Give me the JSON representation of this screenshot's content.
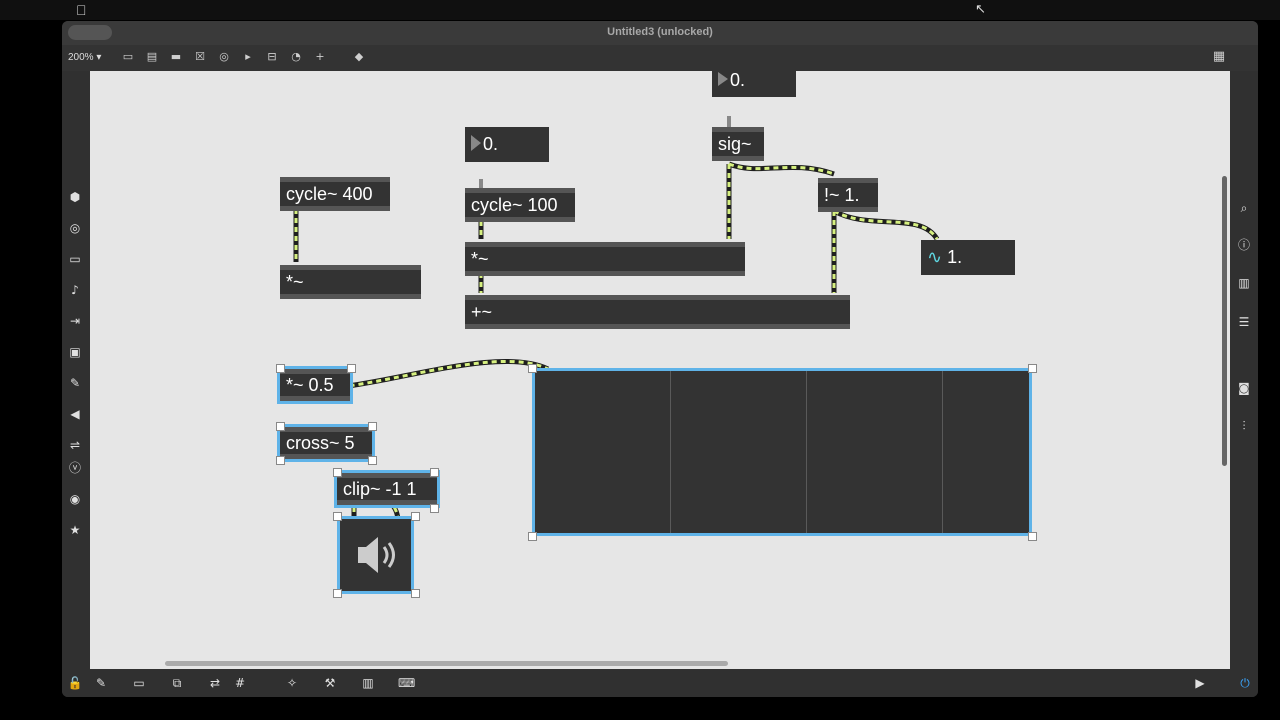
{
  "window": {
    "title": "Untitled3 (unlocked)"
  },
  "toolbar": {
    "zoom": "200% ▾"
  },
  "patch": {
    "number_top": "0.",
    "number_mid": "0.",
    "sig": "sig~",
    "not_minus": "!~ 1.",
    "cycle400": "cycle~ 400",
    "cycle100": "cycle~ 100",
    "mul_left": "*~",
    "mul_mid": "*~",
    "plus": "+~",
    "mul_half": "*~ 0.5",
    "cross": "cross~ 5",
    "clip": "clip~ -1 1",
    "meter_value": "1.",
    "meter_icon": "∿"
  },
  "colors": {
    "accent": "#5fb3e8",
    "cable_signal": "#d6f080"
  },
  "icons": {
    "left": [
      "package-icon",
      "target-icon",
      "presentation-icon",
      "music-note-icon",
      "step-icon",
      "image-icon",
      "paperclip-icon",
      "plug-icon",
      "connector-icon",
      "v-icon",
      "clock-icon",
      "star-icon"
    ],
    "right": [
      "search-icon",
      "info-icon",
      "book-icon",
      "list-icon",
      "camera-icon",
      "mixer-icon"
    ]
  }
}
